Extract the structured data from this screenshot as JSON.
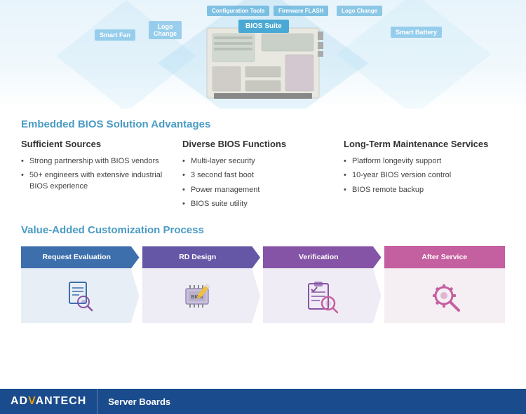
{
  "diagram": {
    "labels": {
      "bios_suite": "BIOS Suite",
      "config_tools": "Configuration Tools",
      "firmware_flash": "Firmware FLASH",
      "logo_change_top": "Logo Change",
      "smart_fan": "Smart Fan",
      "logo_change": "Logo\nChange",
      "smart_battery": "Smart Battery"
    }
  },
  "section1": {
    "title": "Embedded BIOS Solution Advantages",
    "col1": {
      "title": "Sufficient Sources",
      "items": [
        "Strong partnership with BIOS vendors",
        "50+ engineers with extensive industrial BIOS experience"
      ]
    },
    "col2": {
      "title": "Diverse BIOS Functions",
      "items": [
        "Multi-layer security",
        "3 second fast boot",
        "Power management",
        "BIOS suite utility"
      ]
    },
    "col3": {
      "title": "Long-Term Maintenance Services",
      "items": [
        "Platform longevity support",
        "10-year BIOS version control",
        "BIOS remote backup"
      ]
    }
  },
  "section2": {
    "title": "Value-Added Customization Process",
    "steps": [
      {
        "id": "step1",
        "label": "Request Evaluation",
        "color": "#3d6fad",
        "icon": "search-document"
      },
      {
        "id": "step2",
        "label": "RD Design",
        "color": "#6657a6",
        "icon": "bios-chip"
      },
      {
        "id": "step3",
        "label": "Verification",
        "color": "#8654a6",
        "icon": "clipboard-search"
      },
      {
        "id": "step4",
        "label": "After Service",
        "color": "#c45fa0",
        "icon": "wrench"
      }
    ]
  },
  "footer": {
    "brand_prefix": "AD",
    "brand_highlight": "V",
    "brand_suffix": "ANTECH",
    "product": "Server Boards"
  }
}
